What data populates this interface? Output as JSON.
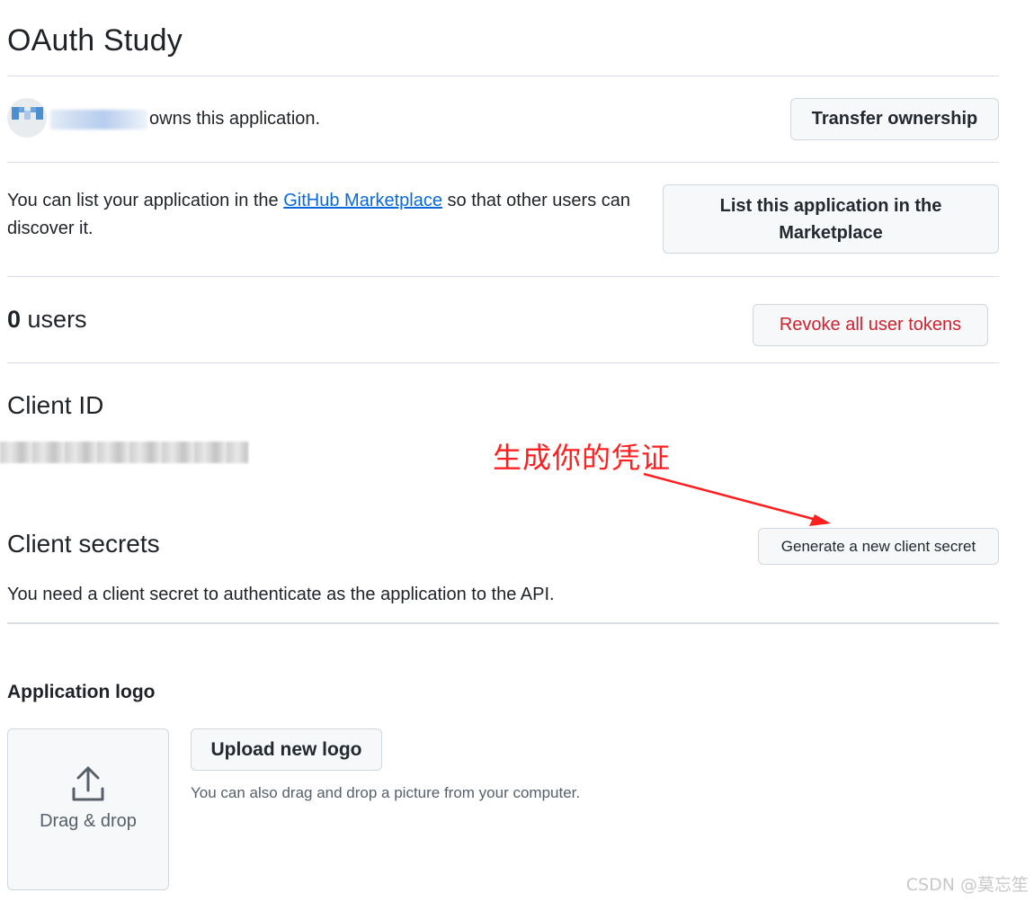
{
  "app": {
    "title": "OAuth Study"
  },
  "owner": {
    "suffix_text": "owns this application.",
    "transfer_label": "Transfer ownership"
  },
  "marketplace": {
    "text_before": "You can list your application in the ",
    "link_text": "GitHub Marketplace",
    "text_after": " so that other users can discover it.",
    "button_label": "List this application in the Marketplace"
  },
  "users": {
    "count": "0",
    "label": " users",
    "revoke_label": "Revoke all user tokens"
  },
  "client_id": {
    "heading": "Client ID"
  },
  "annotation": {
    "text": "生成你的凭证",
    "color": "#ff1f1f"
  },
  "client_secrets": {
    "heading": "Client secrets",
    "generate_label": "Generate a new client secret",
    "note": "You need a client secret to authenticate as the application to the API."
  },
  "logo": {
    "heading": "Application logo",
    "dropzone_label": "Drag & drop",
    "upload_label": "Upload new logo",
    "hint": "You can also drag and drop a picture from your computer."
  },
  "watermark": {
    "text": "CSDN @莫忘笙"
  },
  "colors": {
    "link": "#0969da",
    "danger": "#cf222e",
    "border": "#d0d7de",
    "button_bg": "#f6f8fa"
  }
}
